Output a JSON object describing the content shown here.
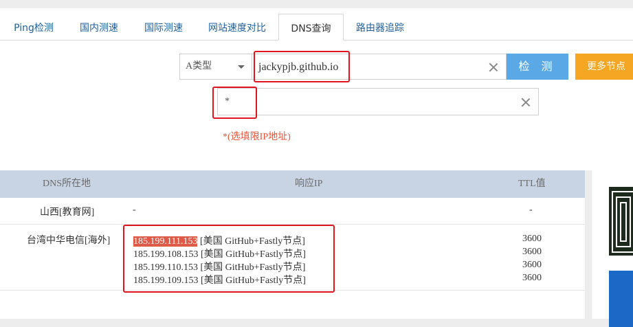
{
  "tabs": [
    {
      "label": "Ping检测",
      "active": false
    },
    {
      "label": "国内测速",
      "active": false
    },
    {
      "label": "国际测速",
      "active": false
    },
    {
      "label": "网站速度对比",
      "active": false
    },
    {
      "label": "DNS查询",
      "active": true
    },
    {
      "label": "路由器追踪",
      "active": false
    }
  ],
  "form": {
    "record_type": "A类型",
    "domain_value": "jackypjb.github.io",
    "ip_value": "*",
    "check_label": "检 测",
    "more_nodes_label": "更多节点",
    "hint": "*(选填限IP地址)"
  },
  "table": {
    "headers": [
      "DNS所在地",
      "响应IP",
      "TTL值"
    ],
    "rows": [
      {
        "location": "山西[教育网]",
        "ips": [
          "-"
        ],
        "ttls": [
          "-"
        ]
      },
      {
        "location": "台湾中华电信[海外]",
        "ips": [
          {
            "ip": "185.199.111.153",
            "desc": "[美国 GitHub+Fastly节点]"
          },
          {
            "ip": "185.199.108.153",
            "desc": "[美国 GitHub+Fastly节点]"
          },
          {
            "ip": "185.199.110.153",
            "desc": "[美国 GitHub+Fastly节点]"
          },
          {
            "ip": "185.199.109.153",
            "desc": "[美国 GitHub+Fastly节点]"
          }
        ],
        "ttls": [
          "3600",
          "3600",
          "3600",
          "3600"
        ]
      }
    ]
  },
  "colors": {
    "accent_blue": "#5aa9e6",
    "accent_orange": "#f5a623",
    "highlight": "#e05a48",
    "annotation_red": "#e0141e"
  }
}
